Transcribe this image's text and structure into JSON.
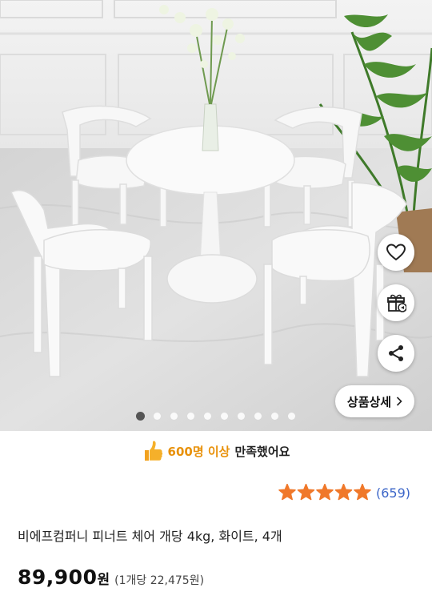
{
  "product": {
    "image_alt": "화이트 원형 테이블과 의자 4개",
    "detail_button_label": "상품상세",
    "carousel": {
      "total": 10,
      "active_index": 0
    },
    "satisfaction": {
      "count": "600명 이상",
      "suffix": "만족했어요"
    },
    "rating": {
      "stars": 5,
      "max": 5,
      "review_count": "(659)"
    },
    "title": "비에프컴퍼니 피너트 체어 개당 4kg, 화이트, 4개",
    "price": "89,900",
    "currency": "원",
    "unit_price": "(1개당 22,475원)"
  },
  "colors": {
    "star": "#f0782a",
    "satisfaction_accent": "#e8910a",
    "review_link": "#3c66c8"
  },
  "icons": {
    "wishlist": "heart-icon",
    "gift": "gift-icon",
    "share": "share-icon",
    "thumb": "thumbs-up-icon",
    "chevron": "chevron-right-icon"
  }
}
